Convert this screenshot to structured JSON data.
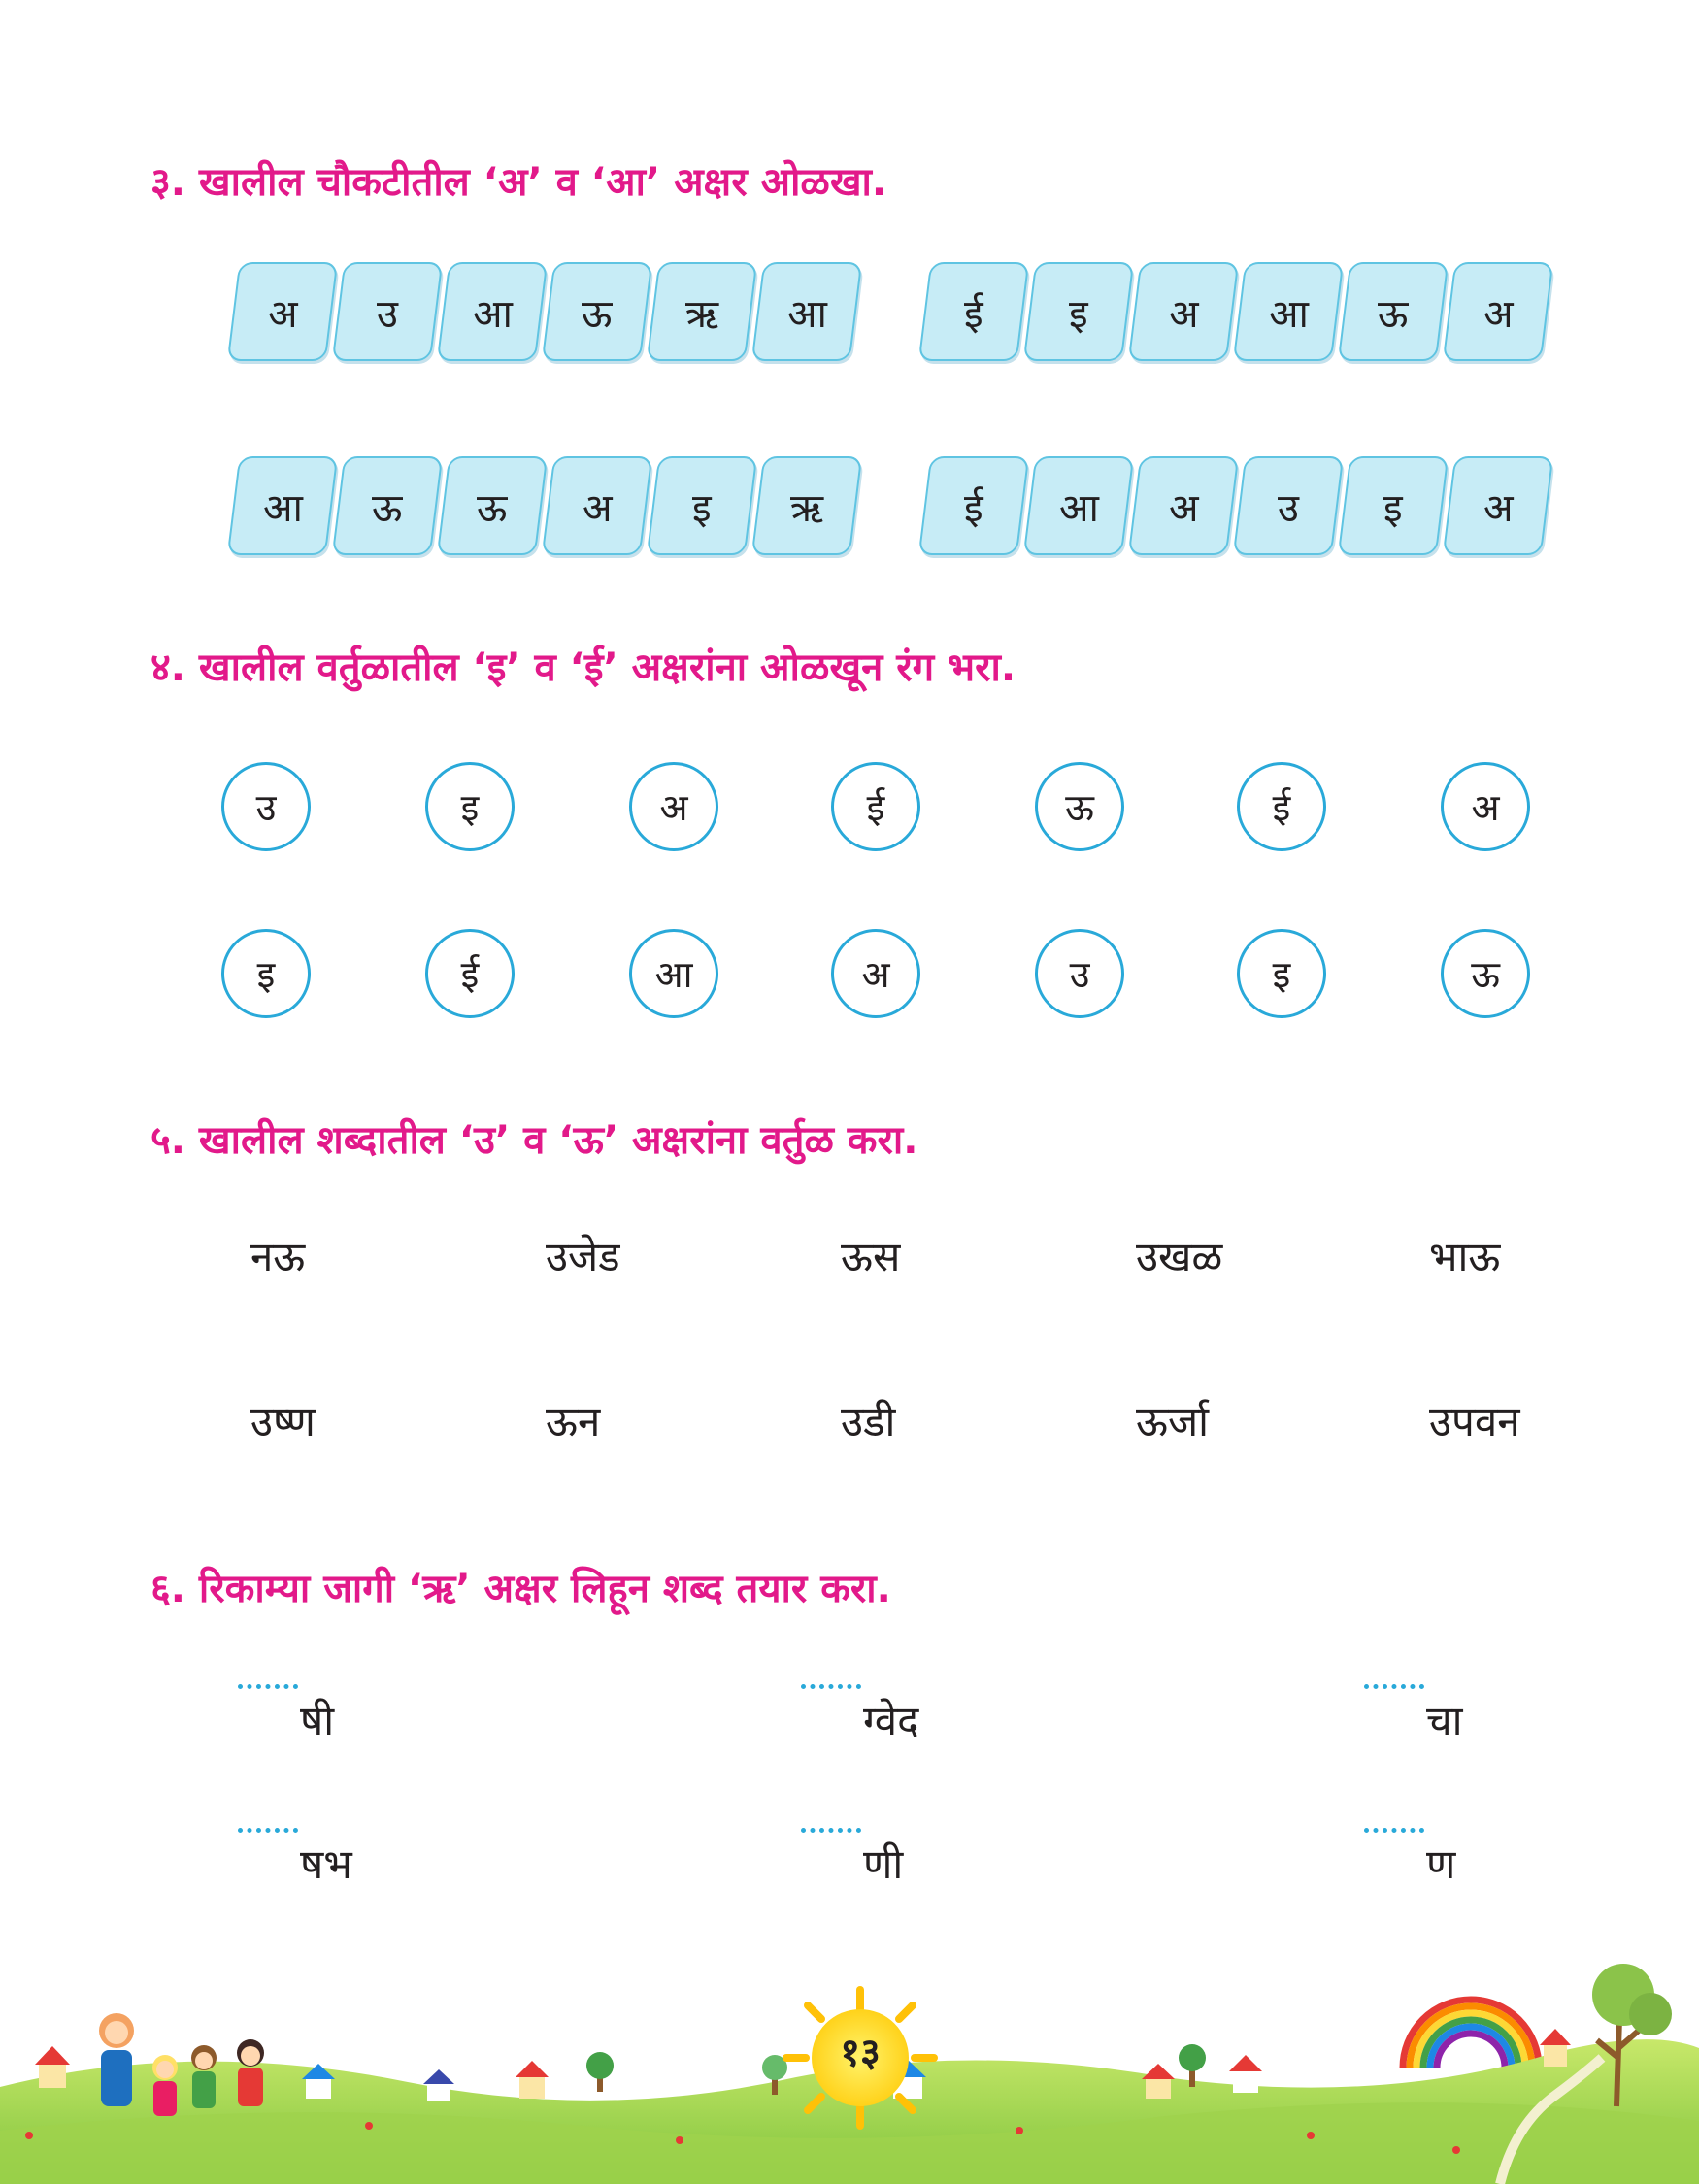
{
  "q3": {
    "heading": "३. खालील चौकटीतील ‘अ’ व ‘आ’ अक्षर ओळखा.",
    "rows": [
      {
        "left": [
          "अ",
          "उ",
          "आ",
          "ऊ",
          "ऋ",
          "आ"
        ],
        "right": [
          "ई",
          "इ",
          "अ",
          "आ",
          "ऊ",
          "अ"
        ]
      },
      {
        "left": [
          "आ",
          "ऊ",
          "ऊ",
          "अ",
          "इ",
          "ऋ"
        ],
        "right": [
          "ई",
          "आ",
          "अ",
          "उ",
          "इ",
          "अ"
        ]
      }
    ]
  },
  "q4": {
    "heading": "४. खालील वर्तुळातील ‘इ’ व ‘ई’ अक्षरांना ओळखून रंग भरा.",
    "rows": [
      [
        "उ",
        "इ",
        "अ",
        "ई",
        "ऊ",
        "ई",
        "अ"
      ],
      [
        "इ",
        "ई",
        "आ",
        "अ",
        "उ",
        "इ",
        "ऊ"
      ]
    ]
  },
  "q5": {
    "heading": "५. खालील शब्दातील ‘उ’ व ‘ऊ’ अक्षरांना वर्तुळ करा.",
    "rows": [
      [
        "नऊ",
        "उजेड",
        "ऊस",
        "उखळ",
        "भाऊ"
      ],
      [
        "उष्ण",
        "ऊन",
        "उडी",
        "ऊर्जा",
        "उपवन"
      ]
    ]
  },
  "q6": {
    "heading": "६. रिकाम्या जागी ‘ऋ’ अक्षर लिहून शब्द तयार करा.",
    "rows": [
      [
        "षी",
        "ग्वेद",
        "चा"
      ],
      [
        "षभ",
        "णी",
        "ण"
      ]
    ]
  },
  "footer": {
    "page_number": "१३"
  },
  "colors": {
    "heading": "#e2198a",
    "tile_fill": "#c7ecf6",
    "tile_border": "#5fc4e2",
    "circle_border": "#29a9d9",
    "text": "#231f20"
  }
}
